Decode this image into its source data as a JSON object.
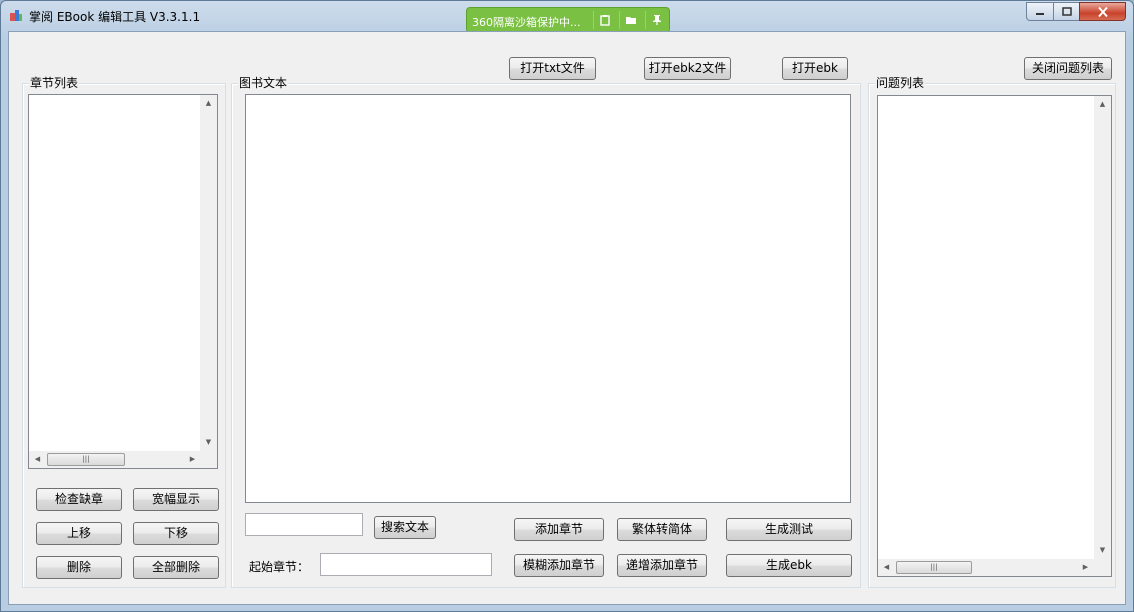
{
  "window": {
    "title": "掌阅 EBook 编辑工具 V3.3.1.1"
  },
  "sandbox": {
    "text": "360隔离沙箱保护中...",
    "icons": [
      "clipboard-icon",
      "folder-icon",
      "pin-icon"
    ]
  },
  "toolbar": {
    "open_txt": "打开txt文件",
    "open_ebk2": "打开ebk2文件",
    "open_ebk": "打开ebk",
    "close_issues": "关闭问题列表"
  },
  "chapter_list": {
    "label": "章节列表",
    "buttons": {
      "check_missing": "检查缺章",
      "wide_display": "宽幅显示",
      "move_up": "上移",
      "move_down": "下移",
      "delete": "删除",
      "delete_all": "全部删除"
    }
  },
  "book_text": {
    "label": "图书文本",
    "search_button": "搜索文本",
    "search_value": "",
    "start_chapter_label": "起始章节：",
    "start_chapter_value": "",
    "buttons": {
      "add_chapter": "添加章节",
      "fuzzy_add_chapter": "模糊添加章节",
      "trad_to_simp": "繁体转简体",
      "incremental_add": "递增添加章节",
      "generate_test": "生成测试",
      "generate_ebk": "生成ebk"
    }
  },
  "issue_list": {
    "label": "问题列表"
  },
  "colors": {
    "sandbox_green": "#7ac043",
    "close_red": "#c9432c",
    "client_bg": "#f0f0f0"
  }
}
